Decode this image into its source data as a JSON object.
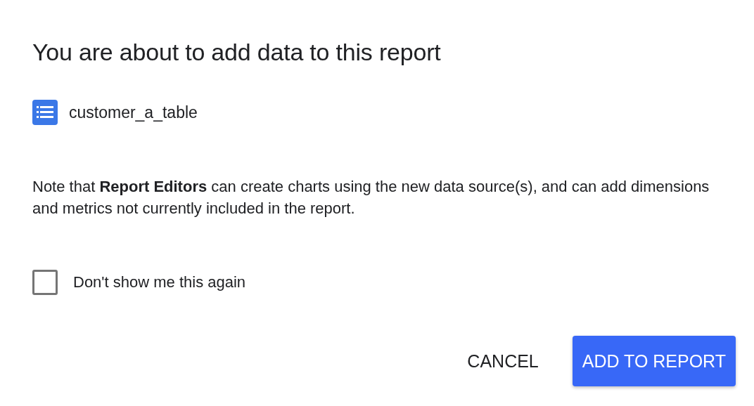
{
  "dialog": {
    "title": "You are about to add data to this report",
    "source": {
      "name": "customer_a_table"
    },
    "note": "Note that **Report Editors** can create charts using the new data source(s), and can add dimensions and metrics not currently included in the report.",
    "checkbox": {
      "label": "Don't show me this again",
      "checked": false
    },
    "buttons": [
      {
        "label": "CANCEL",
        "kind": "text"
      },
      {
        "label": "ADD TO REPORT",
        "kind": "primary"
      }
    ]
  }
}
